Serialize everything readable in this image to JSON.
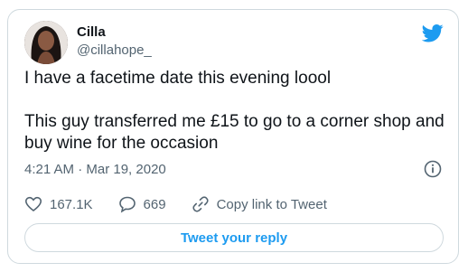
{
  "author": {
    "name": "Cilla",
    "handle": "@cillahope_"
  },
  "tweet": {
    "line1": "I have a facetime date this evening loool",
    "line2": "This guy transferred me £15 to go to a corner shop and buy wine for the occasion"
  },
  "timestamp": "4:21 AM · Mar 19, 2020",
  "actions": {
    "likes": "167.1K",
    "replies": "669",
    "copy_link": "Copy link to Tweet"
  },
  "reply_button": "Tweet your reply",
  "colors": {
    "accent": "#1d9bf0",
    "muted": "#536471",
    "border": "#cfd9de"
  },
  "icons": [
    "twitter-bird-icon",
    "info-icon",
    "heart-icon",
    "reply-bubble-icon",
    "link-icon"
  ]
}
